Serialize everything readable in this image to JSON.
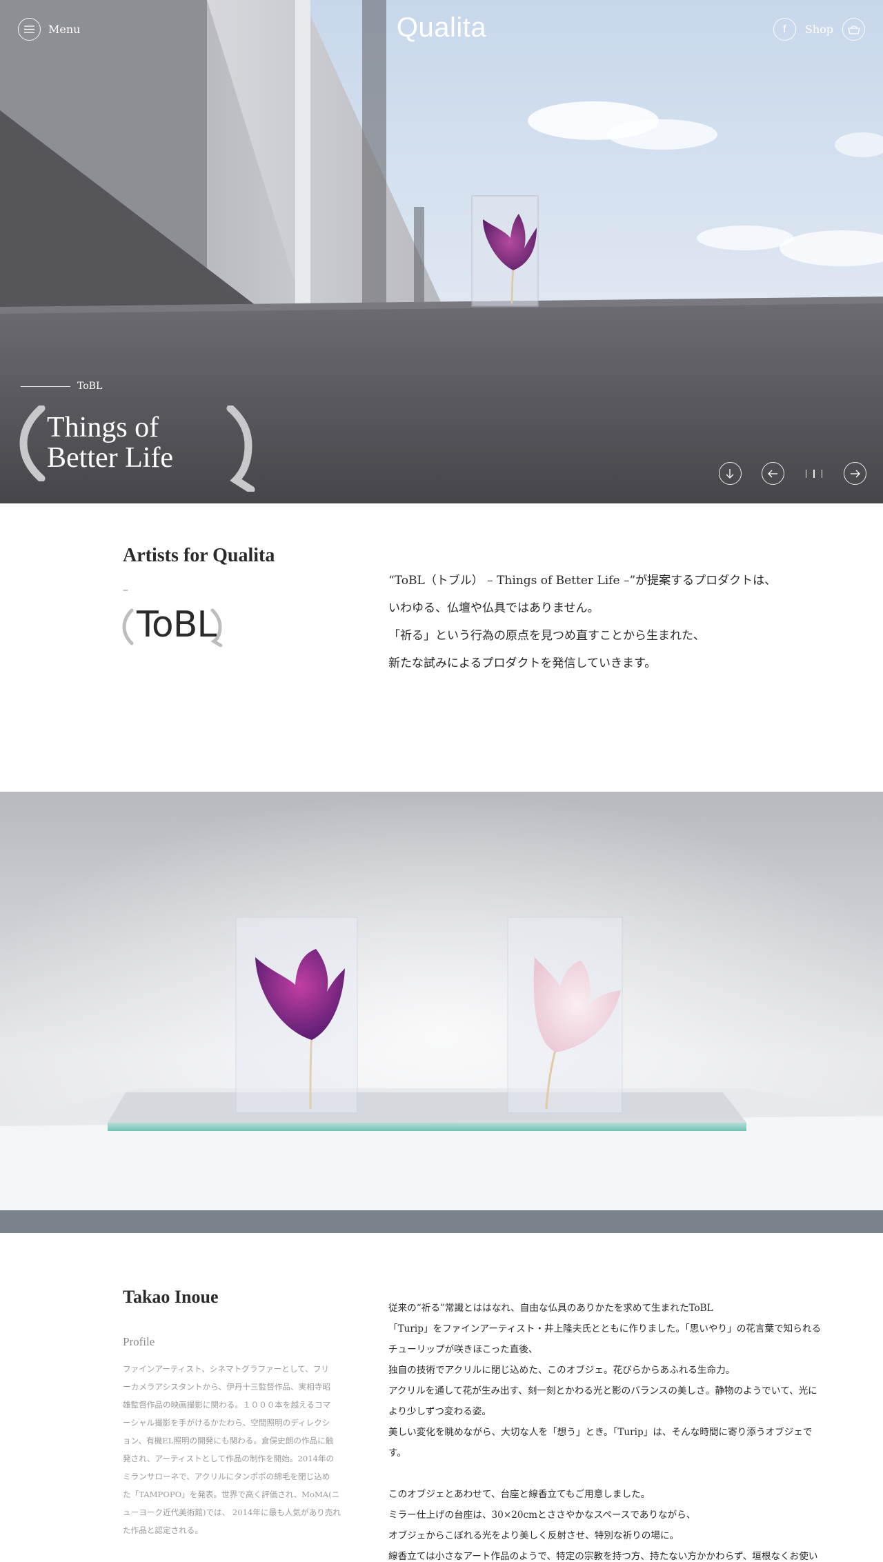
{
  "header": {
    "menu_label": "Menu",
    "logo": "Qualita",
    "shop_label": "Shop",
    "facebook_glyph": "f"
  },
  "hero": {
    "kicker": "ToBL",
    "title_line1": "Things of",
    "title_line2": "Better Life",
    "controls": [
      "arrow-down-icon",
      "arrow-left-icon",
      "pager-icon",
      "arrow-right-icon"
    ]
  },
  "intro": {
    "heading": "Artists for Qualita",
    "dash": "–",
    "brand": "ToBL",
    "lines": [
      "“ToBL（トブル） – Things of Better Life –”が提案するプロダクトは、",
      "いわゆる、仏壇や仏具ではありません。",
      "「祈る」という行為の原点を見つめ直すことから生まれた、",
      "新たな試みによるプロダクトを発信していきます。"
    ]
  },
  "artist": {
    "name": "Takao Inoue",
    "profile_label": "Profile",
    "profile_lines": [
      "ファインアーティスト、シネマトグラファーとして、フリ",
      "ーカメラアシスタントから、伊丹十三監督作品、実相寺昭",
      "雄監督作品の映画撮影に関わる。１０００本を越えるコマ",
      "ーシャル撮影を手がけるかたわら、空間照明のディレクシ",
      "ョン、有機EL照明の開発にも関わる。倉俣史朗の作品に触",
      "発され、アーティストとして作品の制作を開始。2014年の",
      "ミランサローネで、アクリルにタンポポの綿毛を閉じ込め",
      "た「TAMPOPO」を発表。世界で高く評価され、MoMA(ニ",
      "ューヨーク近代美術館)では、 2014年に最も人気があり売れ",
      "た作品と認定される。"
    ],
    "story_lines": [
      "従来の“祈る”常識とははなれ、自由な仏具のありかたを求めて生まれたToBL",
      "「Turip」をファインアーティスト・井上隆夫氏とともに作りました。「思いやり」の花言葉で知られる",
      "チューリップが咲きほこった直後、",
      "独自の技術でアクリルに閉じ込めた、このオブジェ。花びらからあふれる生命力。",
      "アクリルを通して花が生み出す、刻一刻とかわる光と影のバランスの美しさ。静物のようでいて、光に",
      "より少しずつ変わる姿。",
      "美しい変化を眺めながら、大切な人を「想う」とき。「Turip」は、そんな時間に寄り添うオブジェで",
      "す。"
    ],
    "story_lines_2": [
      "このオブジェとあわせて、台座と線香立てもご用意しました。",
      "ミラー仕上げの台座は、30×20cmとささやかなスペースでありながら、",
      "オブジェからこぼれる光をより美しく反射させ、特別な祈りの場に。",
      "線香立ては小さなアート作品のようで、特定の宗教を持つ方、持たない方かかわらず、垣根なくお使い"
    ]
  },
  "colors": {
    "accent_white": "#ffffff",
    "text_dark": "#2a2a2a",
    "text_muted": "#9a9a9a",
    "hero_wall": "#5a595e",
    "photo_band": "#7a828c"
  }
}
